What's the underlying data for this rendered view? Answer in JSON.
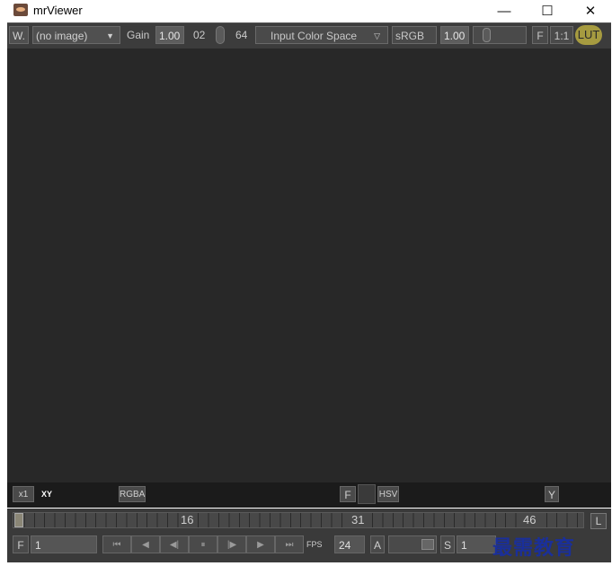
{
  "window": {
    "title": "mrViewer",
    "minimize": "—",
    "maximize": "☐",
    "close": "✕"
  },
  "toolbar": {
    "w_button": "W.",
    "image_select": "(no image)",
    "gain_label": "Gain",
    "gain_value": "1.00",
    "exposure_low": "02",
    "exposure_high": "64",
    "input_color_space": "Input Color Space",
    "display_space": "sRGB",
    "gamma_value": "1.00",
    "f_button": "F",
    "ratio_button": "1:1",
    "lut_button": "LUT"
  },
  "pixel_bar": {
    "zoom": "x1",
    "coord_label": "XY",
    "rgba_button": "RGBA",
    "f_button": "F",
    "hsv_button": "HSV",
    "y_button": "Y"
  },
  "timeline": {
    "frame_labels": [
      "16",
      "31",
      "46"
    ],
    "end_button": "L"
  },
  "transport": {
    "frame_label": "F",
    "frame_value": "1",
    "fps_label": "FPS",
    "fps_value": "24",
    "audio_label": "A",
    "start_label": "S",
    "start_value": "1",
    "buttons": [
      "⏮",
      "◀",
      "◀|",
      "⏸",
      "|▶",
      "▶",
      "⏭"
    ]
  },
  "watermark": "最需教育",
  "colors": {
    "toolbar_bg": "#3c3c3c",
    "viewport_bg": "#282828",
    "lut_accent": "#a69b40"
  }
}
